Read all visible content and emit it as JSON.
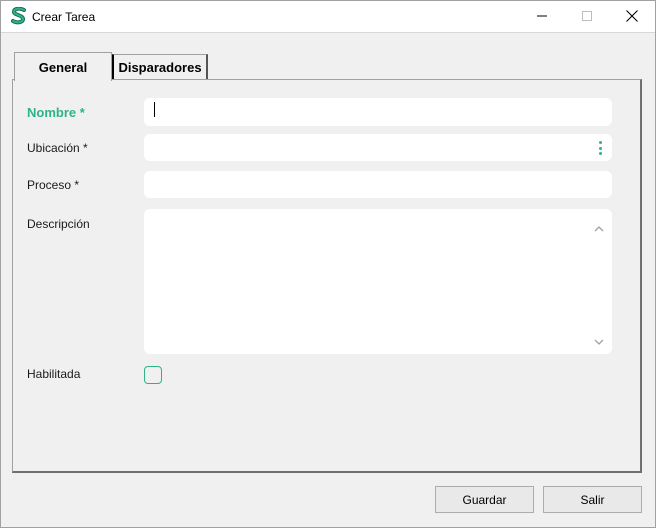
{
  "window": {
    "title": "Crear Tarea",
    "accent_color": "#2db38a"
  },
  "tabs": [
    {
      "label": "General",
      "active": true
    },
    {
      "label": "Disparadores",
      "active": false
    }
  ],
  "form": {
    "name_label": "Nombre *",
    "name_value": "",
    "location_label": "Ubicación *",
    "location_value": "",
    "process_label": "Proceso *",
    "process_value": "",
    "description_label": "Descripción",
    "description_value": "",
    "enabled_label": "Habilitada",
    "enabled_checked": false
  },
  "buttons": {
    "save_label": "Guardar",
    "exit_label": "Salir"
  },
  "icons": {
    "app": "app-logo-icon",
    "minimize": "minimize-icon",
    "maximize": "maximize-icon",
    "close": "close-icon",
    "more": "kebab-menu-icon"
  }
}
